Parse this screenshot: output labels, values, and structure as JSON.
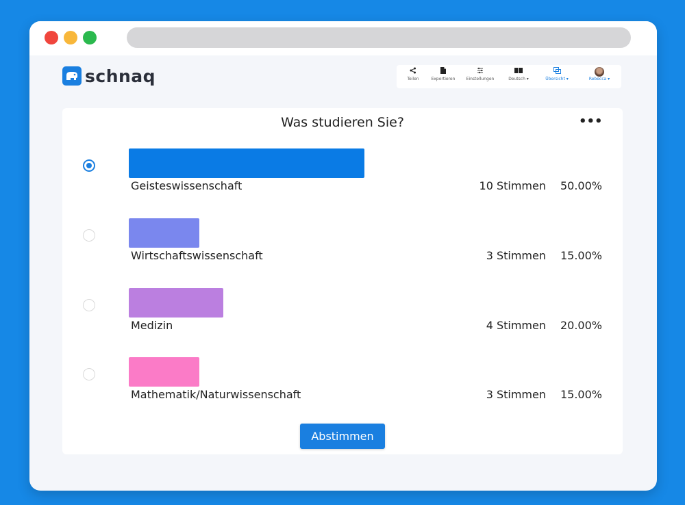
{
  "brand": {
    "name": "schnaq",
    "color": "#1a7fe0"
  },
  "navbar": {
    "items": [
      {
        "icon": "share-icon",
        "label": "Teilen"
      },
      {
        "icon": "document-icon",
        "label": "Exportieren"
      },
      {
        "icon": "settings-icon",
        "label": "Einstellungen"
      },
      {
        "icon": "language-icon",
        "label": "Deutsch ▾"
      },
      {
        "icon": "overview-icon",
        "label": "Übersicht ▾"
      },
      {
        "icon": "avatar",
        "label": "Rebecca ▾"
      }
    ]
  },
  "poll": {
    "question": "Was studieren Sie?",
    "vote_button": "Abstimmen",
    "options": [
      {
        "label": "Geisteswissenschaft",
        "votes": "10 Stimmen",
        "percent": "50.00%",
        "share": 50,
        "color": "#0a7be5",
        "selected": true
      },
      {
        "label": "Wirtschaftswissenschaft",
        "votes": "3 Stimmen",
        "percent": "15.00%",
        "share": 15,
        "color": "#7a87ee",
        "selected": false
      },
      {
        "label": "Medizin",
        "votes": "4 Stimmen",
        "percent": "20.00%",
        "share": 20,
        "color": "#bb7fe0",
        "selected": false
      },
      {
        "label": "Mathematik/Naturwissenschaft",
        "votes": "3 Stimmen",
        "percent": "15.00%",
        "share": 15,
        "color": "#fb7bc7",
        "selected": false
      }
    ]
  }
}
